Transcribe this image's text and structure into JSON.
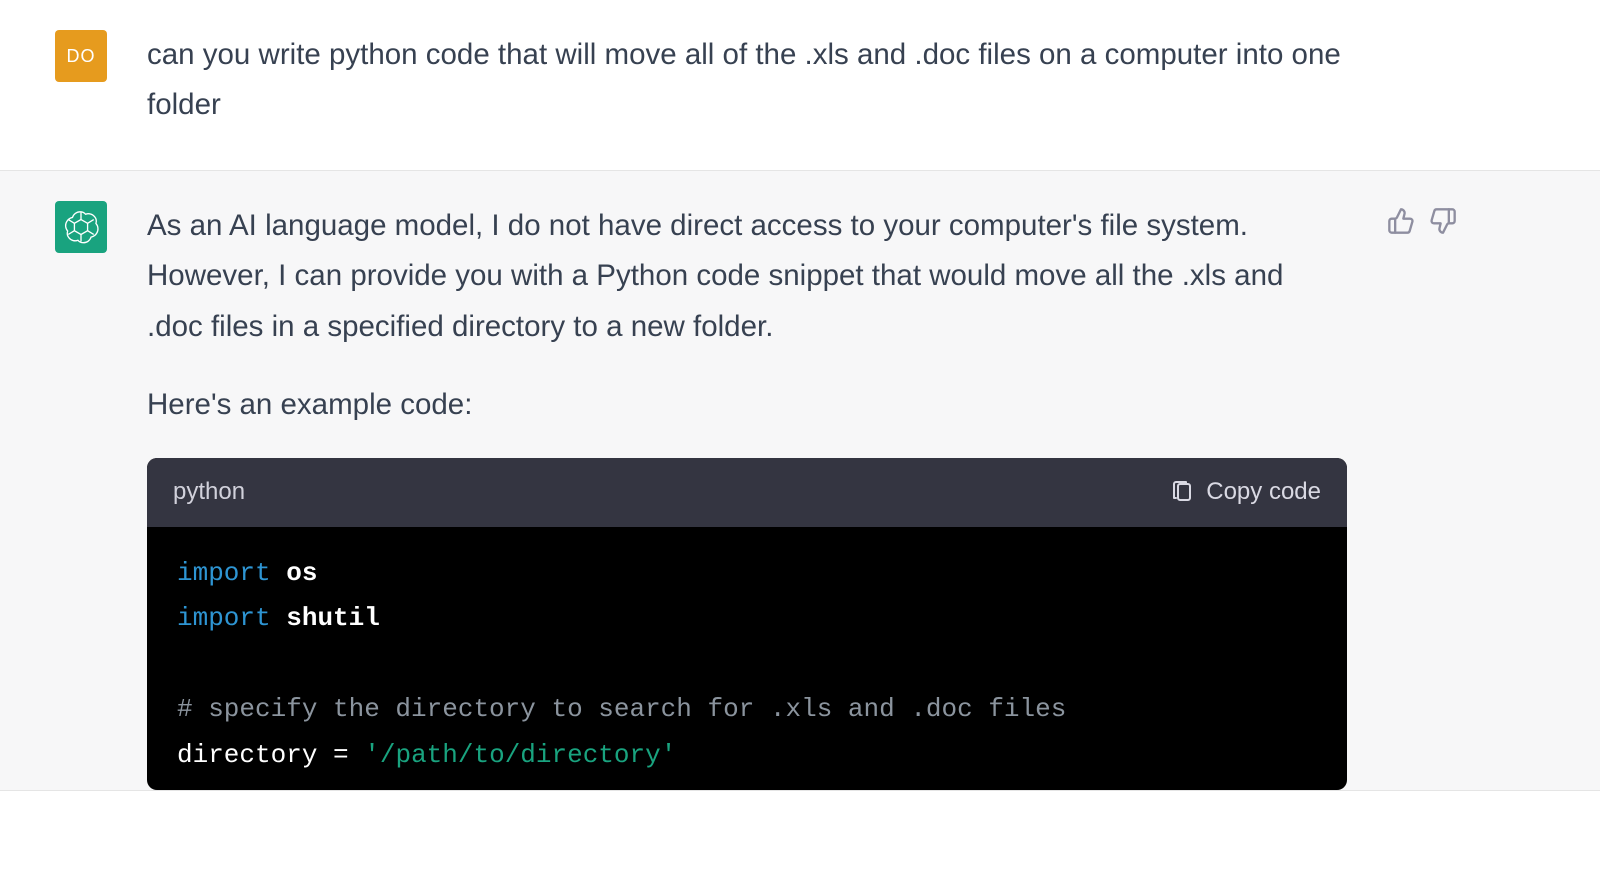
{
  "user": {
    "avatar_initials": "DO",
    "message": "can you write python code that will move all of the .xls and .doc files on a computer into one folder"
  },
  "assistant": {
    "paragraphs": [
      "As an AI language model, I do not have direct access to your computer's file system. However, I can provide you with a Python code snippet that would move all the .xls and .doc files in a specified directory to a new folder.",
      "Here's an example code:"
    ],
    "code": {
      "language": "python",
      "copy_label": "Copy code",
      "tokens": {
        "import1": "import",
        "os": "os",
        "import2": "import",
        "shutil": "shutil",
        "comment1": "# specify the directory to search for .xls and .doc files",
        "directory_var": "directory",
        "eq": "=",
        "path_str": "'/path/to/directory'"
      }
    }
  }
}
